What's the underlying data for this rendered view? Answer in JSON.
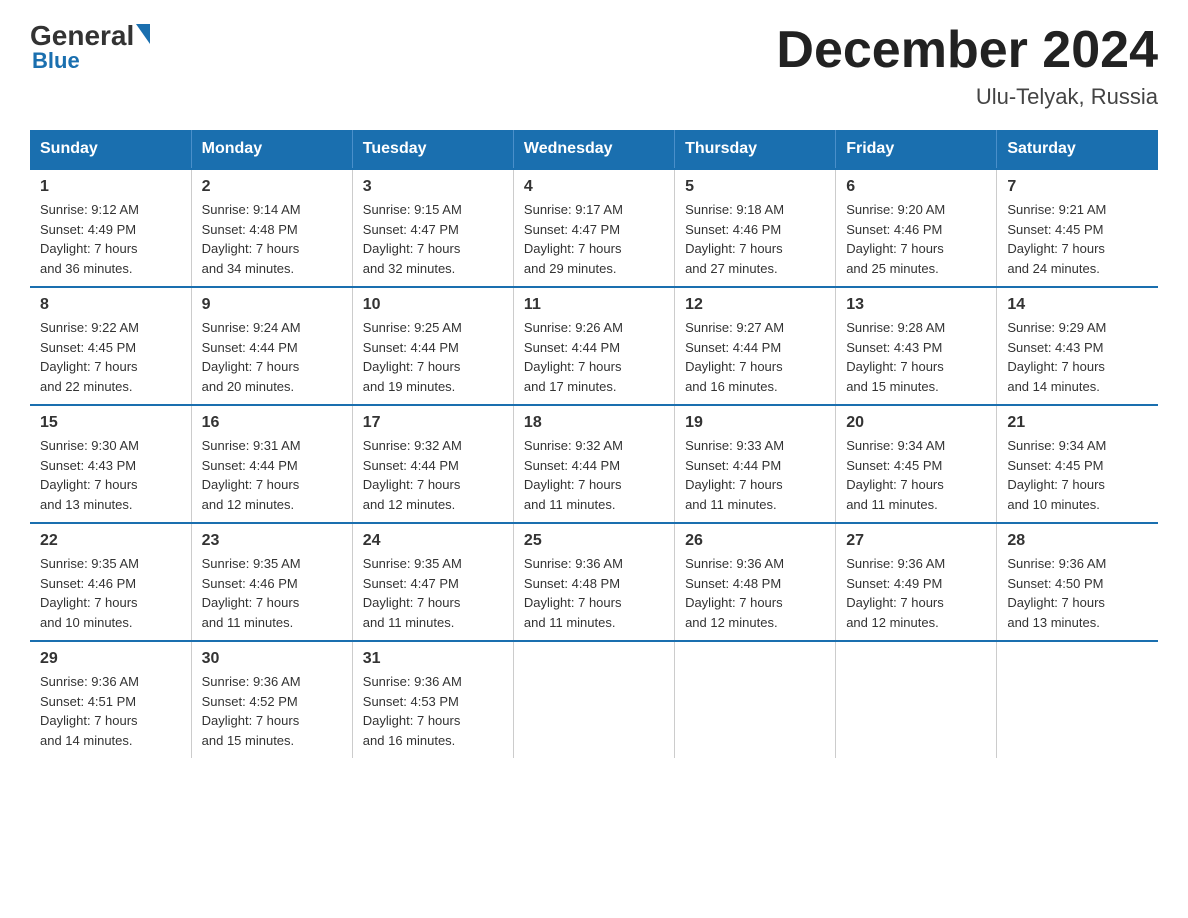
{
  "header": {
    "logo_general": "General",
    "logo_blue": "Blue",
    "month_title": "December 2024",
    "location": "Ulu-Telyak, Russia"
  },
  "weekdays": [
    "Sunday",
    "Monday",
    "Tuesday",
    "Wednesday",
    "Thursday",
    "Friday",
    "Saturday"
  ],
  "weeks": [
    [
      {
        "day": "1",
        "sunrise": "9:12 AM",
        "sunset": "4:49 PM",
        "daylight": "7 hours and 36 minutes."
      },
      {
        "day": "2",
        "sunrise": "9:14 AM",
        "sunset": "4:48 PM",
        "daylight": "7 hours and 34 minutes."
      },
      {
        "day": "3",
        "sunrise": "9:15 AM",
        "sunset": "4:47 PM",
        "daylight": "7 hours and 32 minutes."
      },
      {
        "day": "4",
        "sunrise": "9:17 AM",
        "sunset": "4:47 PM",
        "daylight": "7 hours and 29 minutes."
      },
      {
        "day": "5",
        "sunrise": "9:18 AM",
        "sunset": "4:46 PM",
        "daylight": "7 hours and 27 minutes."
      },
      {
        "day": "6",
        "sunrise": "9:20 AM",
        "sunset": "4:46 PM",
        "daylight": "7 hours and 25 minutes."
      },
      {
        "day": "7",
        "sunrise": "9:21 AM",
        "sunset": "4:45 PM",
        "daylight": "7 hours and 24 minutes."
      }
    ],
    [
      {
        "day": "8",
        "sunrise": "9:22 AM",
        "sunset": "4:45 PM",
        "daylight": "7 hours and 22 minutes."
      },
      {
        "day": "9",
        "sunrise": "9:24 AM",
        "sunset": "4:44 PM",
        "daylight": "7 hours and 20 minutes."
      },
      {
        "day": "10",
        "sunrise": "9:25 AM",
        "sunset": "4:44 PM",
        "daylight": "7 hours and 19 minutes."
      },
      {
        "day": "11",
        "sunrise": "9:26 AM",
        "sunset": "4:44 PM",
        "daylight": "7 hours and 17 minutes."
      },
      {
        "day": "12",
        "sunrise": "9:27 AM",
        "sunset": "4:44 PM",
        "daylight": "7 hours and 16 minutes."
      },
      {
        "day": "13",
        "sunrise": "9:28 AM",
        "sunset": "4:43 PM",
        "daylight": "7 hours and 15 minutes."
      },
      {
        "day": "14",
        "sunrise": "9:29 AM",
        "sunset": "4:43 PM",
        "daylight": "7 hours and 14 minutes."
      }
    ],
    [
      {
        "day": "15",
        "sunrise": "9:30 AM",
        "sunset": "4:43 PM",
        "daylight": "7 hours and 13 minutes."
      },
      {
        "day": "16",
        "sunrise": "9:31 AM",
        "sunset": "4:44 PM",
        "daylight": "7 hours and 12 minutes."
      },
      {
        "day": "17",
        "sunrise": "9:32 AM",
        "sunset": "4:44 PM",
        "daylight": "7 hours and 12 minutes."
      },
      {
        "day": "18",
        "sunrise": "9:32 AM",
        "sunset": "4:44 PM",
        "daylight": "7 hours and 11 minutes."
      },
      {
        "day": "19",
        "sunrise": "9:33 AM",
        "sunset": "4:44 PM",
        "daylight": "7 hours and 11 minutes."
      },
      {
        "day": "20",
        "sunrise": "9:34 AM",
        "sunset": "4:45 PM",
        "daylight": "7 hours and 11 minutes."
      },
      {
        "day": "21",
        "sunrise": "9:34 AM",
        "sunset": "4:45 PM",
        "daylight": "7 hours and 10 minutes."
      }
    ],
    [
      {
        "day": "22",
        "sunrise": "9:35 AM",
        "sunset": "4:46 PM",
        "daylight": "7 hours and 10 minutes."
      },
      {
        "day": "23",
        "sunrise": "9:35 AM",
        "sunset": "4:46 PM",
        "daylight": "7 hours and 11 minutes."
      },
      {
        "day": "24",
        "sunrise": "9:35 AM",
        "sunset": "4:47 PM",
        "daylight": "7 hours and 11 minutes."
      },
      {
        "day": "25",
        "sunrise": "9:36 AM",
        "sunset": "4:48 PM",
        "daylight": "7 hours and 11 minutes."
      },
      {
        "day": "26",
        "sunrise": "9:36 AM",
        "sunset": "4:48 PM",
        "daylight": "7 hours and 12 minutes."
      },
      {
        "day": "27",
        "sunrise": "9:36 AM",
        "sunset": "4:49 PM",
        "daylight": "7 hours and 12 minutes."
      },
      {
        "day": "28",
        "sunrise": "9:36 AM",
        "sunset": "4:50 PM",
        "daylight": "7 hours and 13 minutes."
      }
    ],
    [
      {
        "day": "29",
        "sunrise": "9:36 AM",
        "sunset": "4:51 PM",
        "daylight": "7 hours and 14 minutes."
      },
      {
        "day": "30",
        "sunrise": "9:36 AM",
        "sunset": "4:52 PM",
        "daylight": "7 hours and 15 minutes."
      },
      {
        "day": "31",
        "sunrise": "9:36 AM",
        "sunset": "4:53 PM",
        "daylight": "7 hours and 16 minutes."
      },
      null,
      null,
      null,
      null
    ]
  ],
  "labels": {
    "sunrise": "Sunrise:",
    "sunset": "Sunset:",
    "daylight": "Daylight:"
  }
}
